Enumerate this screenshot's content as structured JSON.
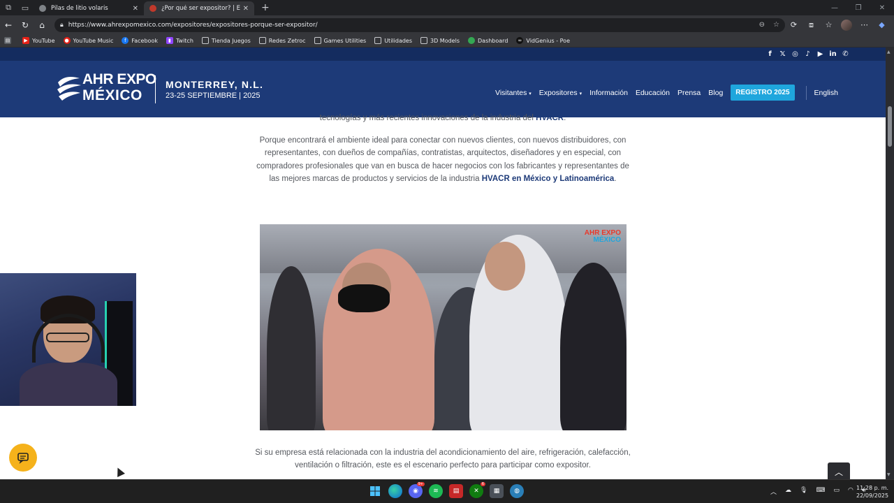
{
  "browser": {
    "tabs": [
      {
        "title": "Pilas de litio volaris",
        "active": false
      },
      {
        "title": "¿Por qué ser expositor? | Empresa",
        "active": true
      }
    ],
    "url": "https://www.ahrexpomexico.com/expositores/expositores-porque-ser-expositor/",
    "bookmarks": [
      "YouTube",
      "YouTube Music",
      "Facebook",
      "Twitch",
      "Tienda Juegos",
      "Redes Zetroc",
      "Games Utilities",
      "Utilidades",
      "3D Models",
      "Dashboard",
      "VidGenius - Poe"
    ]
  },
  "site": {
    "logo_line1": "AHR EXPO",
    "logo_line2": "MÉXICO",
    "city": "MONTERREY, N.L.",
    "dates": "23-25 SEPTIEMBRE | 2025",
    "menu": {
      "visitantes": "Visitantes",
      "expositores": "Expositores",
      "informacion": "Información",
      "educacion": "Educación",
      "prensa": "Prensa",
      "blog": "Blog",
      "registro": "REGISTRO 2025",
      "english": "English"
    },
    "social_icons": [
      "facebook-icon",
      "x-icon",
      "instagram-icon",
      "tiktok-icon",
      "youtube-icon",
      "linkedin-icon",
      "whatsapp-icon"
    ]
  },
  "content": {
    "para0_a": "tecnologías y más recientes innovaciones de la industria del ",
    "para0_b": "HVACR",
    "para0_c": ".",
    "para1_a": "Porque encontrará el ambiente ideal para conectar con nuevos clientes, con nuevos distribuidores, con representantes, con dueños de compañías, contratistas, arquitectos, diseñadores y en especial, con compradores profesionales que van en busca de hacer negocios con los fabricantes y representantes de las mejores marcas de productos y servicios de la industria ",
    "para1_b": "HVACR en México y Latinoamérica",
    "para1_c": ".",
    "photo_watermark_1": "AHR EXPO",
    "photo_watermark_2": "MÉXICO",
    "para2": "Si su empresa está relacionada con la industria del acondicionamiento del aire, refrigeración, calefacción, ventilación o filtración, este es el escenario perfecto para participar como expositor."
  },
  "taskbar": {
    "time": "11:28 p. m.",
    "date": "22/09/2025",
    "discord_badge": "9+",
    "xbox_badge": "6"
  },
  "colors": {
    "header_bg": "#1d3a78",
    "topstrip_bg": "#142c5f",
    "cta_bg": "#1fa6dd",
    "chat_btn": "#f5b21b",
    "text": "#55585e"
  }
}
